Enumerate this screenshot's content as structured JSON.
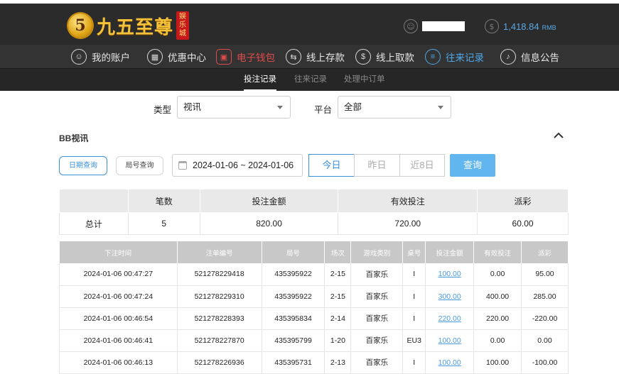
{
  "header": {
    "logo_number": "5",
    "logo_text": "九五至尊",
    "logo_badge": [
      "娱",
      "乐",
      "城"
    ],
    "balance": "1,418.84",
    "balance_unit": "RMB"
  },
  "nav": [
    {
      "label": "我的账户",
      "icon": "user-icon",
      "glyph": "☺"
    },
    {
      "label": "优惠中心",
      "icon": "gift-icon",
      "glyph": "▦"
    },
    {
      "label": "电子钱包",
      "icon": "wallet-icon",
      "glyph": "▣"
    },
    {
      "label": "线上存款",
      "icon": "deposit-icon",
      "glyph": "⇆"
    },
    {
      "label": "线上取款",
      "icon": "withdraw-icon",
      "glyph": "$"
    },
    {
      "label": "往来记录",
      "icon": "records-icon",
      "glyph": "≡"
    },
    {
      "label": "信息公告",
      "icon": "bell-icon",
      "glyph": "♪"
    }
  ],
  "subnav": [
    "投注记录",
    "往来记录",
    "处理中订单"
  ],
  "filters": {
    "type_label": "类型",
    "type_value": "视讯",
    "platform_label": "平台",
    "platform_value": "全部"
  },
  "section_title": "BB视讯",
  "query": {
    "date_query": "日期查询",
    "round_query": "局号查询",
    "date_range": "2024-01-06 ~ 2024-01-06",
    "today": "今日",
    "yesterday": "昨日",
    "last8": "近8日",
    "submit": "查询"
  },
  "summary": {
    "headers": [
      "",
      "笔数",
      "投注金额",
      "有效投注",
      "派彩"
    ],
    "row": [
      "总计",
      "5",
      "820.00",
      "720.00",
      "60.00"
    ]
  },
  "detail": {
    "headers": [
      "下注时间",
      "注单编号",
      "局号",
      "场次",
      "游戏类别",
      "桌号",
      "投注金额",
      "有效投注",
      "派彩"
    ],
    "rows": [
      [
        "2024-01-06 00:47:27",
        "521278229418",
        "435395922",
        "2-15",
        "百家乐",
        "I",
        "100.00",
        "0.00",
        "95.00"
      ],
      [
        "2024-01-06 00:47:24",
        "521278229310",
        "435395922",
        "2-15",
        "百家乐",
        "I",
        "300.00",
        "400.00",
        "285.00"
      ],
      [
        "2024-01-06 00:46:54",
        "521278228393",
        "435395834",
        "2-14",
        "百家乐",
        "I",
        "220.00",
        "220.00",
        "-220.00"
      ],
      [
        "2024-01-06 00:46:41",
        "521278227870",
        "435395799",
        "1-20",
        "百家乐",
        "EU3",
        "100.00",
        "0.00",
        "0.00"
      ],
      [
        "2024-01-06 00:46:13",
        "521278226936",
        "435395731",
        "2-13",
        "百家乐",
        "I",
        "100.00",
        "100.00",
        "-100.00"
      ]
    ]
  }
}
